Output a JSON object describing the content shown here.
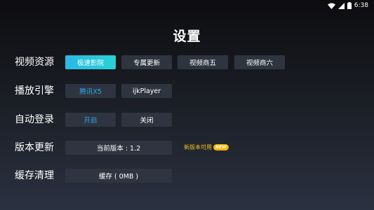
{
  "status_bar": {
    "time": "6:38"
  },
  "title": "设置",
  "rows": {
    "video_source": {
      "label": "视频资源",
      "options": [
        "极速影院",
        "专属更新",
        "视频商五",
        "视频商六"
      ],
      "selected": "极速影院"
    },
    "player_engine": {
      "label": "播放引擎",
      "options": [
        "腾讯X5",
        "ijkPlayer"
      ],
      "selected": "腾讯X5"
    },
    "auto_login": {
      "label": "自动登录",
      "options": [
        "开启",
        "关闭"
      ],
      "selected": "开启"
    },
    "version": {
      "label": "版本更新",
      "current_version": "当前版本 : 1.2",
      "update_note": "新版本可用",
      "badge": "NEW"
    },
    "cache": {
      "label": "缓存清理",
      "cache_button": "缓存 ( 0MB )"
    }
  },
  "colors": {
    "accent_gradient_start": "#2ab8e6",
    "accent_gradient_end": "#27d3d6",
    "accent_text": "#2ea8ee",
    "button_bg": "#2f3540",
    "notice": "#f5c31c"
  },
  "icons": [
    "wifi-icon",
    "signal-icon",
    "battery-icon"
  ]
}
